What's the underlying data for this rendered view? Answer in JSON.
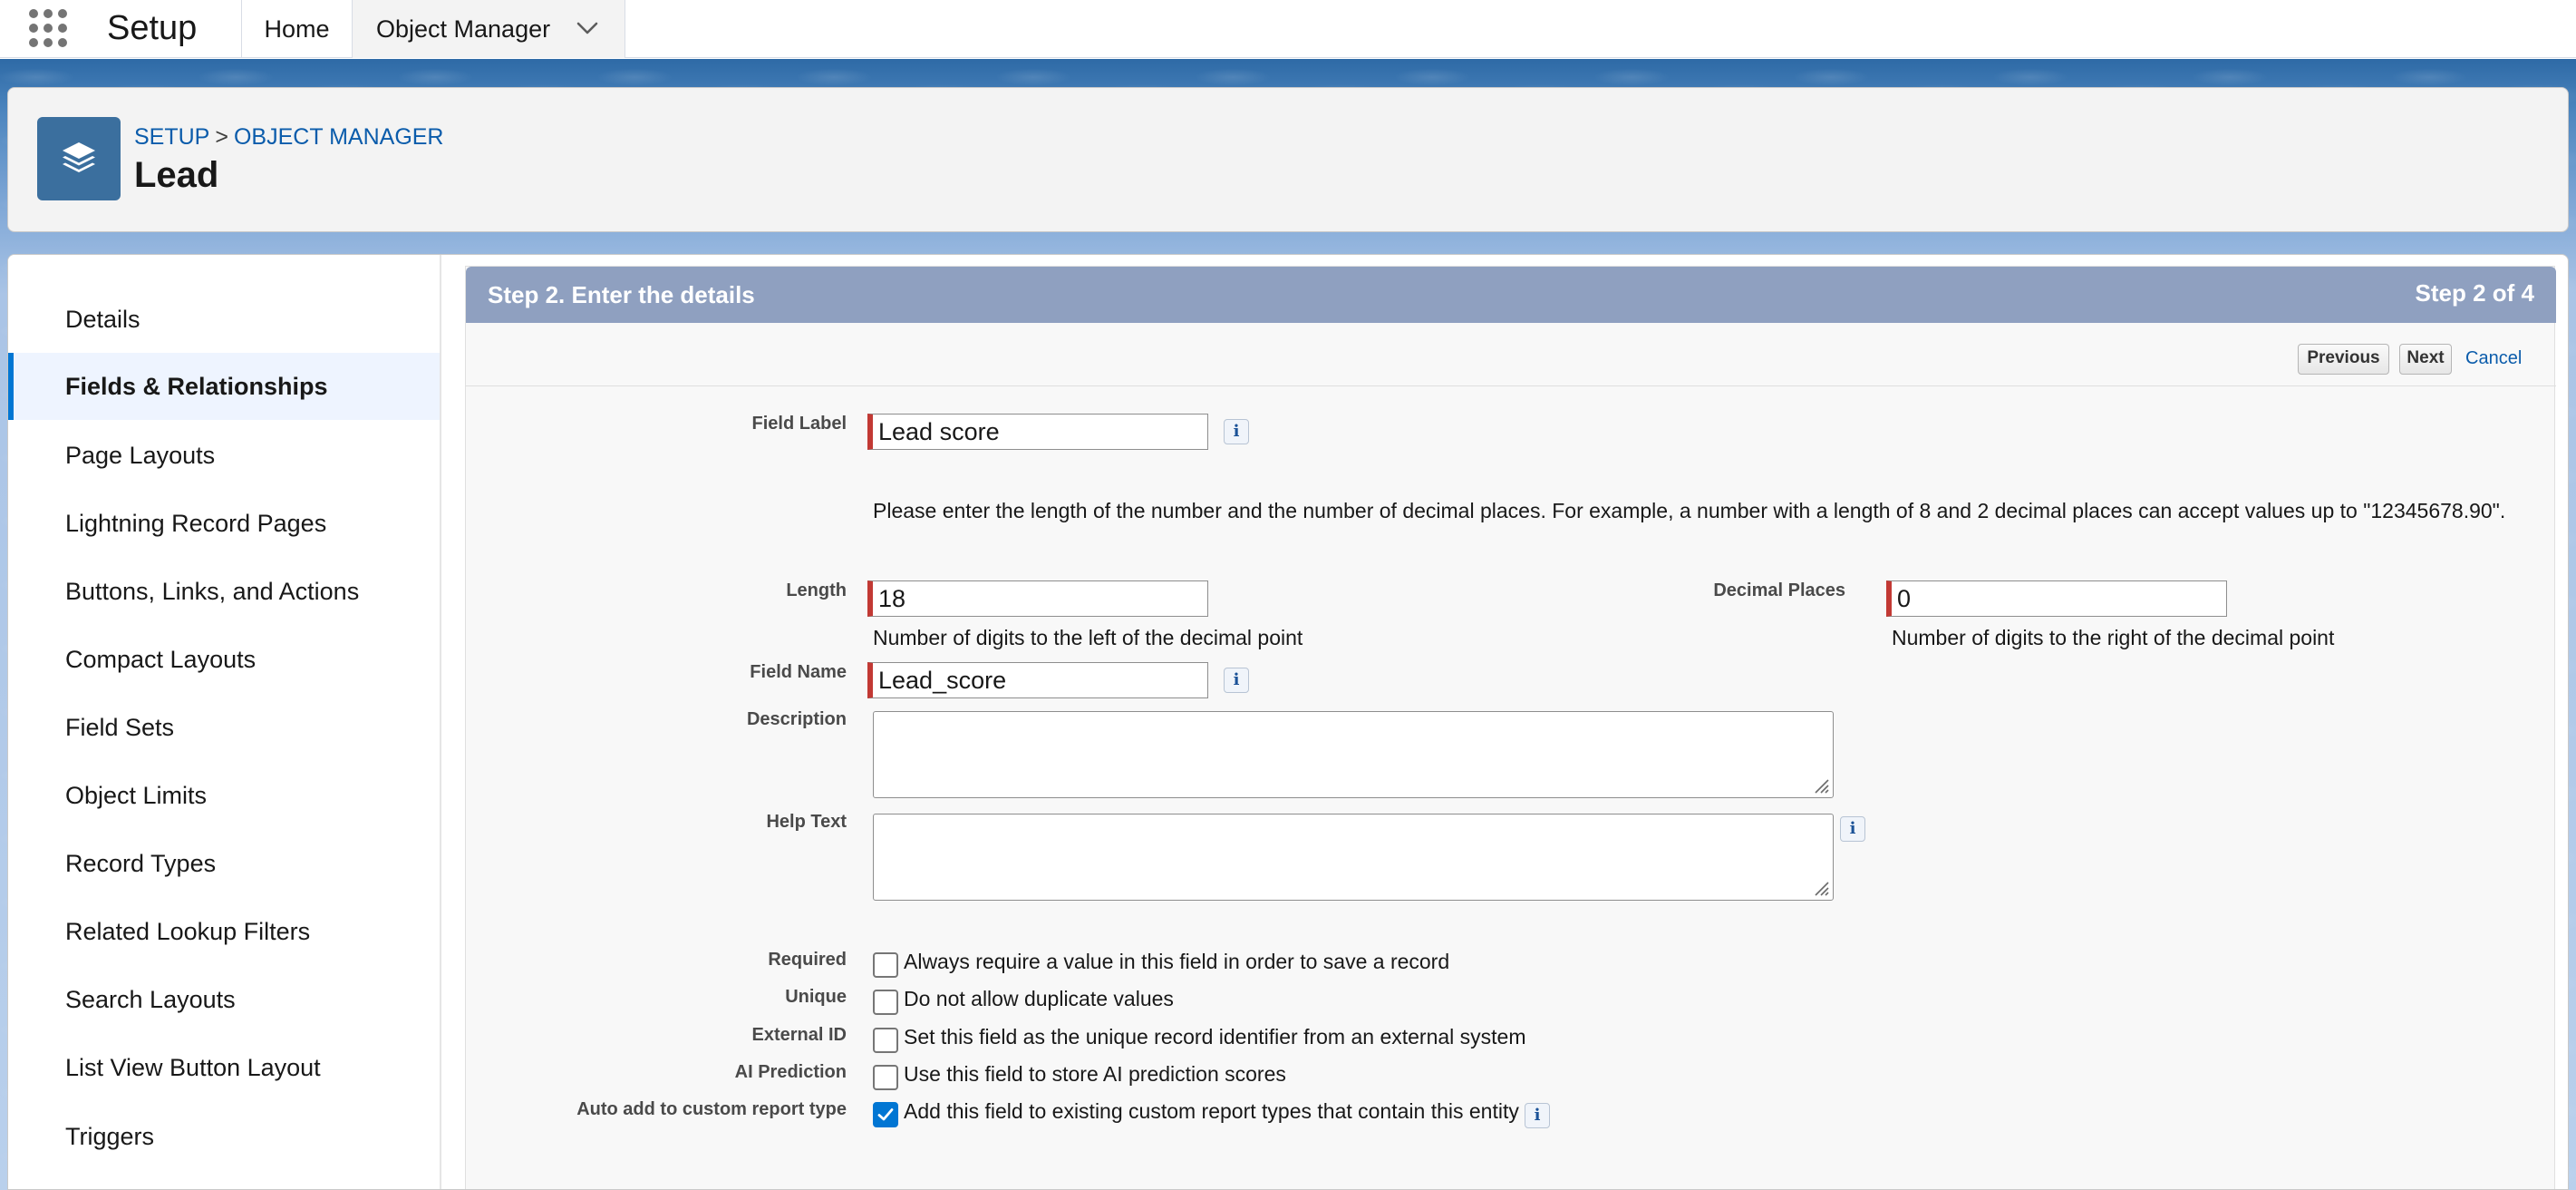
{
  "topbar": {
    "app_name": "Setup",
    "tabs": [
      {
        "label": "Home"
      },
      {
        "label": "Object Manager"
      }
    ]
  },
  "header": {
    "breadcrumb": [
      "SETUP",
      "OBJECT MANAGER"
    ],
    "breadcrumb_separator": ">",
    "title": "Lead"
  },
  "sidebar": {
    "items": [
      {
        "label": "Details"
      },
      {
        "label": "Fields & Relationships",
        "active": true
      },
      {
        "label": "Page Layouts"
      },
      {
        "label": "Lightning Record Pages"
      },
      {
        "label": "Buttons, Links, and Actions"
      },
      {
        "label": "Compact Layouts"
      },
      {
        "label": "Field Sets"
      },
      {
        "label": "Object Limits"
      },
      {
        "label": "Record Types"
      },
      {
        "label": "Related Lookup Filters"
      },
      {
        "label": "Search Layouts"
      },
      {
        "label": "List View Button Layout"
      },
      {
        "label": "Triggers"
      }
    ]
  },
  "wizard": {
    "step_title": "Step 2. Enter the details",
    "step_count": "Step 2 of 4",
    "buttons": {
      "previous": "Previous",
      "next": "Next",
      "cancel": "Cancel"
    },
    "info_glyph": "i",
    "fields": {
      "field_label": {
        "label": "Field Label",
        "value": "Lead score"
      },
      "instructions": "Please enter the length of the number and the number of decimal places. For example, a number with a length of 8 and 2 decimal places can accept values up to \"12345678.90\".",
      "length": {
        "label": "Length",
        "value": "18",
        "help": "Number of digits to the left of the decimal point"
      },
      "decimal_places": {
        "label": "Decimal Places",
        "value": "0",
        "help": "Number of digits to the right of the decimal point"
      },
      "field_name": {
        "label": "Field Name",
        "value": "Lead_score"
      },
      "description": {
        "label": "Description",
        "value": ""
      },
      "help_text": {
        "label": "Help Text",
        "value": ""
      }
    },
    "options": [
      {
        "label": "Required",
        "text": "Always require a value in this field in order to save a record",
        "checked": false
      },
      {
        "label": "Unique",
        "text": "Do not allow duplicate values",
        "checked": false
      },
      {
        "label": "External ID",
        "text": "Set this field as the unique record identifier from an external system",
        "checked": false
      },
      {
        "label": "AI Prediction",
        "text": "Use this field to store AI prediction scores",
        "checked": false
      },
      {
        "label": "Auto add to custom report type",
        "text": "Add this field to existing custom report types that contain this entity",
        "checked": true
      }
    ]
  },
  "colors": {
    "accent": "#0176d3",
    "required_bar": "#c23934",
    "step_bar": "#8fa0c0",
    "link": "#0b5cab"
  },
  "icons": {
    "app_launcher": "waffle-grid-icon",
    "object_icon": "stacked-layers-icon",
    "tab_dropdown": "chevron-down-icon",
    "info": "info-icon",
    "checkmark": "checkmark-icon"
  }
}
